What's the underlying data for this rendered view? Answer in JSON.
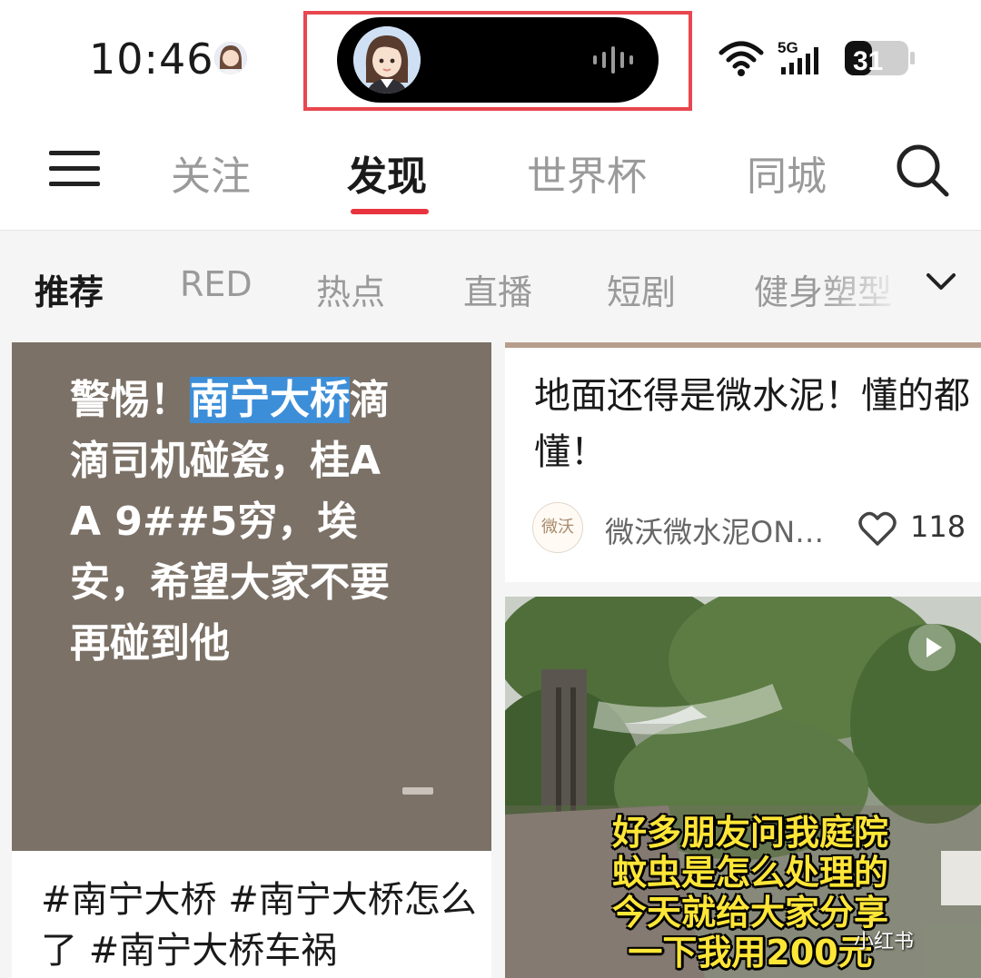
{
  "status_bar": {
    "time": "10:46",
    "network_label": "5G",
    "battery_level": "31"
  },
  "top_nav": {
    "tabs": [
      {
        "label": "关注",
        "active": false
      },
      {
        "label": "发现",
        "active": true
      },
      {
        "label": "世界杯",
        "active": false
      },
      {
        "label": "同城",
        "active": false
      }
    ],
    "accent_color": "#e8343f"
  },
  "channels": {
    "items": [
      {
        "label": "推荐",
        "active": true
      },
      {
        "label": "RED",
        "active": false
      },
      {
        "label": "热点",
        "active": false
      },
      {
        "label": "直播",
        "active": false
      },
      {
        "label": "短剧",
        "active": false
      },
      {
        "label": "健身塑型",
        "active": false
      }
    ]
  },
  "feed": {
    "left_card": {
      "cover_prefix": "警惕！",
      "cover_highlight": "南宁大桥",
      "cover_rest": "滴滴司机碰瓷，桂AA 9##5穷，埃安，希望大家不要再碰到他",
      "title": "#南宁大桥 #南宁大桥怎么了 #南宁大桥车祸"
    },
    "right_card_1": {
      "title": "地面还得是微水泥！懂的都懂！",
      "author_avatar_text": "微沃",
      "author": "微沃微水泥ON…",
      "likes": "118"
    },
    "right_card_2": {
      "subtitle_lines": [
        "好多朋友问我庭院",
        "蚊虫是怎么处理的",
        "今天就给大家分享",
        "一下我用200元"
      ],
      "watermark": "小红书"
    }
  }
}
